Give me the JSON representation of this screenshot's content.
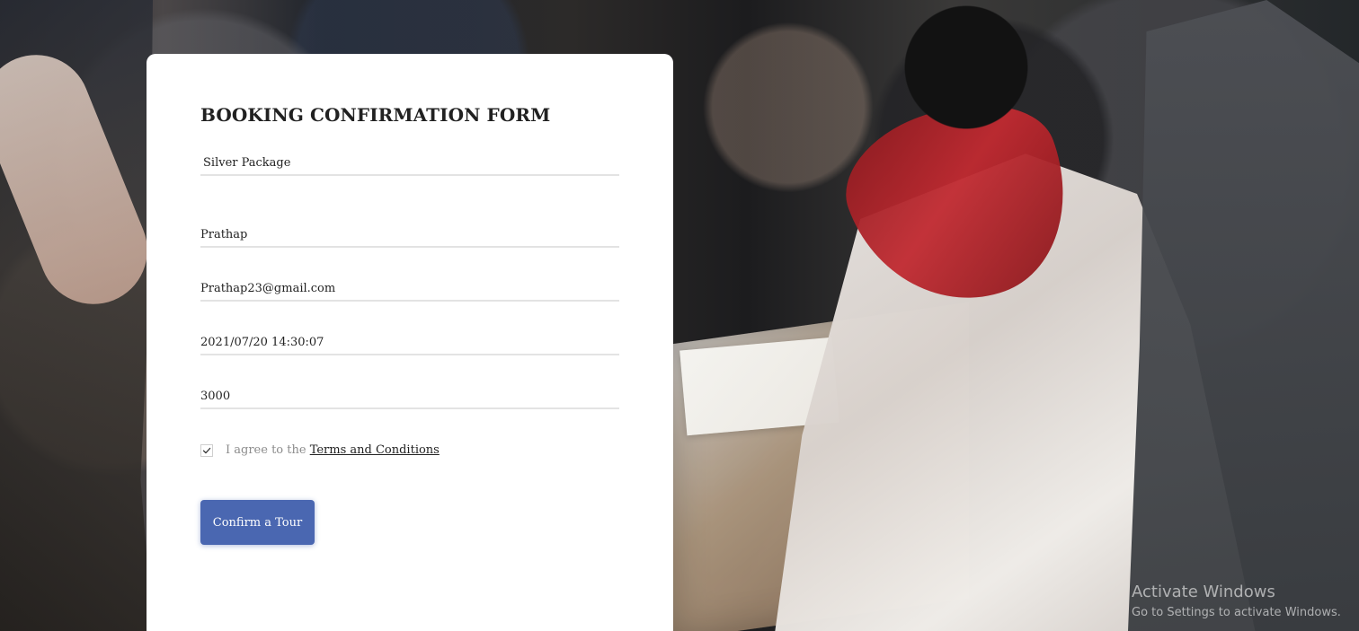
{
  "form": {
    "title": "BOOKING CONFIRMATION FORM",
    "package": "Silver Package",
    "name": "Prathap",
    "email": "Prathap23@gmail.com",
    "datetime": "2021/07/20 14:30:07",
    "amount": "3000",
    "terms_prefix": "I agree to the ",
    "terms_link": "Terms and Conditions",
    "terms_checked": true,
    "button_label": "Confirm a Tour"
  },
  "watermark": {
    "title": "Activate Windows",
    "subtitle": "Go to Settings to activate Windows."
  },
  "colors": {
    "card_background": "#ffffff",
    "button_background": "#4a67b1",
    "text_primary": "#212121",
    "text_muted": "#8c8c8c"
  },
  "icons": {
    "checkbox": "checkmark-icon"
  }
}
